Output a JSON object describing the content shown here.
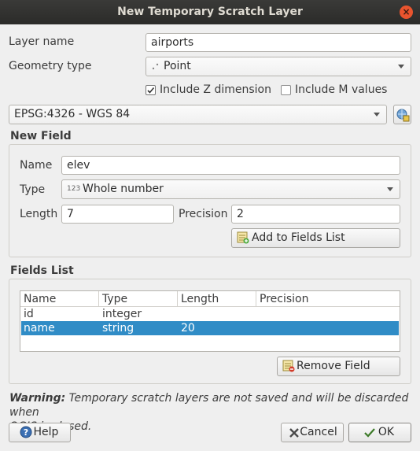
{
  "window": {
    "title": "New Temporary Scratch Layer",
    "close_glyph": "×"
  },
  "layer_name": {
    "label": "Layer name",
    "value": "airports"
  },
  "geometry_type": {
    "label": "Geometry type",
    "value": "Point",
    "icon": "point-geometry-icon"
  },
  "include_z": {
    "label": "Include Z dimension",
    "checked": true
  },
  "include_m": {
    "label": "Include M values",
    "checked": false
  },
  "crs": {
    "value": "EPSG:4326 - WGS 84",
    "select_button_icon": "crs-select-icon"
  },
  "new_field": {
    "title": "New Field",
    "name_label": "Name",
    "name_value": "elev",
    "type_label": "Type",
    "type_badge": "123",
    "type_value": "Whole number",
    "length_label": "Length",
    "length_value": "7",
    "precision_label": "Precision",
    "precision_value": "2",
    "add_button": "Add to Fields List"
  },
  "fields_list": {
    "title": "Fields List",
    "columns": [
      "Name",
      "Type",
      "Length",
      "Precision"
    ],
    "rows": [
      {
        "name": "id",
        "type": "integer",
        "length": "",
        "precision": ""
      },
      {
        "name": "name",
        "type": "string",
        "length": "20",
        "precision": "",
        "selected": true
      }
    ],
    "remove_button": "Remove Field"
  },
  "warning": {
    "bold": "Warning:",
    "text": " Temporary scratch layers are not saved and will be discarded when",
    "text2": "QGIS is closed."
  },
  "buttons": {
    "help": "Help",
    "cancel": "Cancel",
    "ok": "OK"
  },
  "colors": {
    "selection": "#308cc6",
    "titlebar": "#2f2f2d",
    "close": "#e9542e"
  }
}
